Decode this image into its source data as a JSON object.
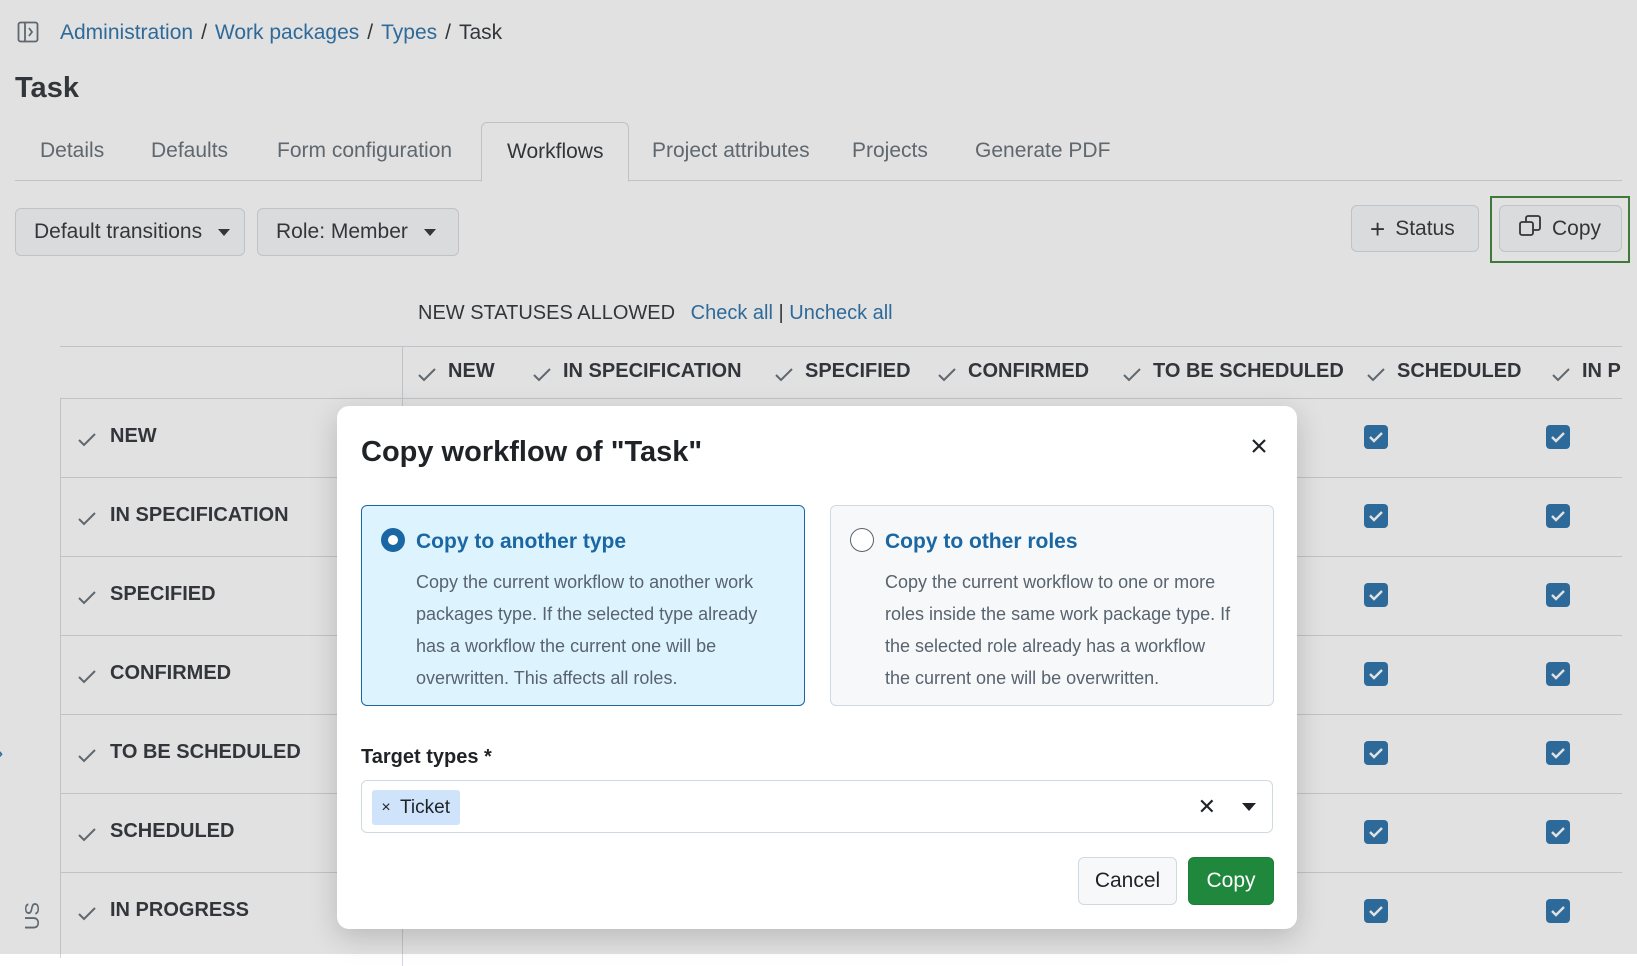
{
  "breadcrumb": {
    "items": [
      "Administration",
      "Work packages",
      "Types"
    ],
    "separator": "/",
    "current": "Task"
  },
  "page_title": "Task",
  "tabs": [
    {
      "label": "Details",
      "active": false
    },
    {
      "label": "Defaults",
      "active": false
    },
    {
      "label": "Form configuration",
      "active": false
    },
    {
      "label": "Workflows",
      "active": true
    },
    {
      "label": "Project attributes",
      "active": false
    },
    {
      "label": "Projects",
      "active": false
    },
    {
      "label": "Generate PDF",
      "active": false
    }
  ],
  "toolbar": {
    "transitions_label": "Default transitions",
    "role_label": "Role: Member",
    "status_label": "Status",
    "copy_label": "Copy"
  },
  "matrix": {
    "heading": "NEW STATUSES ALLOWED",
    "check_all": "Check all",
    "divider": "|",
    "uncheck_all": "Uncheck all",
    "columns": [
      "NEW",
      "IN SPECIFICATION",
      "SPECIFIED",
      "CONFIRMED",
      "TO BE SCHEDULED",
      "SCHEDULED",
      "IN P"
    ],
    "rows": [
      "NEW",
      "IN SPECIFICATION",
      "SPECIFIED",
      "CONFIRMED",
      "TO BE SCHEDULED",
      "SCHEDULED",
      "IN PROGRESS"
    ],
    "side_label": "US"
  },
  "modal": {
    "title": "Copy workflow of \"Task\"",
    "options": [
      {
        "title": "Copy to another type",
        "description": "Copy the current workflow to another work packages type. If the selected type already has a workflow the current one will be overwritten. This affects all roles.",
        "selected": true
      },
      {
        "title": "Copy to other roles",
        "description": "Copy the current workflow to one or more roles inside the same work package type. If the selected role already has a workflow the current one will be overwritten.",
        "selected": false
      }
    ],
    "target_label": "Target types *",
    "selected_tokens": [
      "Ticket"
    ],
    "cancel_label": "Cancel",
    "submit_label": "Copy"
  },
  "colors": {
    "link": "#1a67a3",
    "primary_button": "#1f883d",
    "selected_option_bg": "#ddf4ff",
    "highlight_outline": "#2f7a2b"
  }
}
